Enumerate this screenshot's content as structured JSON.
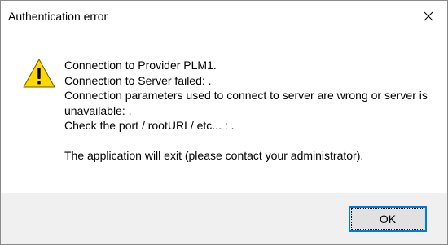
{
  "window": {
    "title": "Authentication error",
    "close_icon": "close-icon"
  },
  "message": {
    "icon": "warning-icon",
    "lines": [
      "Connection to Provider PLM1.",
      "Connection to Server failed: .",
      "Connection parameters used to connect to server are wrong or server is unavailable: .",
      "Check the port / rootURI / etc... : .",
      "",
      "The application will exit (please contact your administrator)."
    ]
  },
  "buttons": {
    "ok_label": "OK"
  },
  "colors": {
    "footer_background": "#f0f0f0",
    "focus_border": "#0078d7",
    "button_face": "#e1e1e1",
    "warning_yellow": "#ffd800"
  }
}
